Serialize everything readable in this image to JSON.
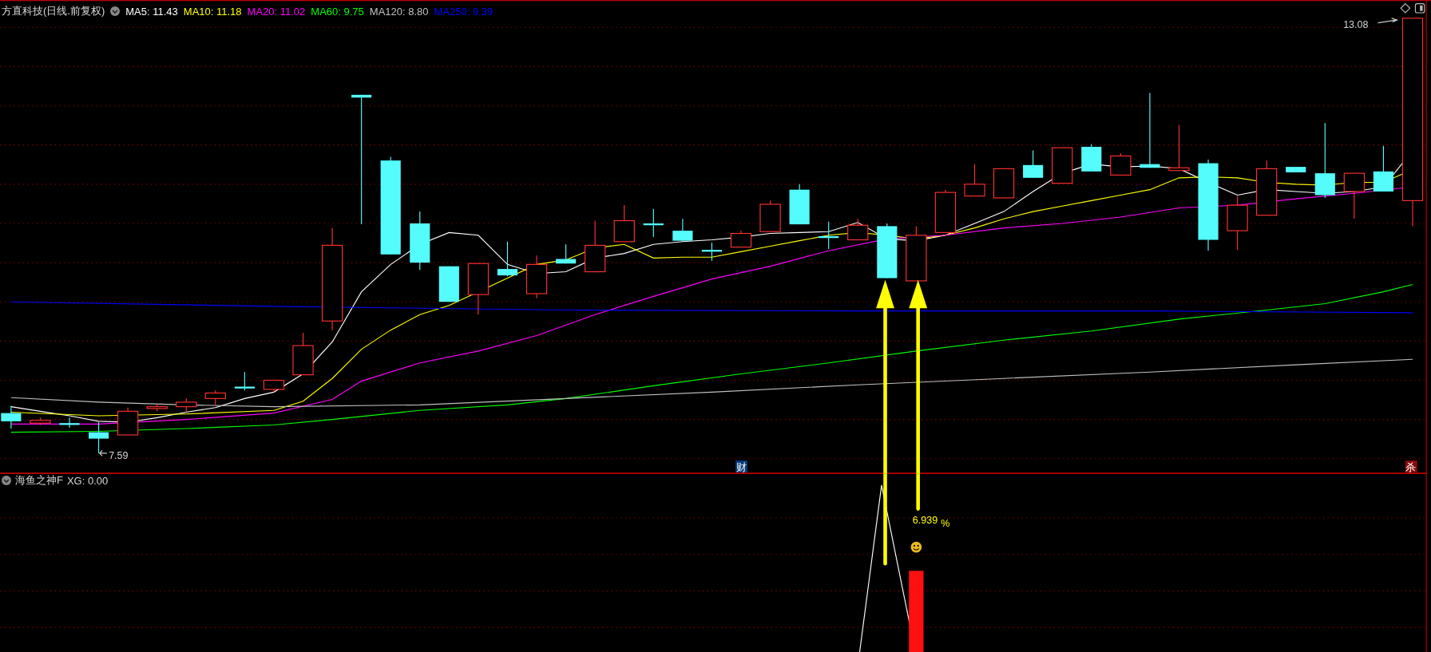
{
  "header": {
    "title": "方直科技(日线.前复权)",
    "indicators": [
      {
        "label": "MA5: 11.43",
        "color": "#ffffff"
      },
      {
        "label": "MA10: 11.18",
        "color": "#ffff00"
      },
      {
        "label": "MA20: 11.02",
        "color": "#ff00ff"
      },
      {
        "label": "MA60: 9.75",
        "color": "#00ff00"
      },
      {
        "label": "MA120: 8.80",
        "color": "#c0c0c0"
      },
      {
        "label": "MA250: 9.39",
        "color": "#0000ff"
      }
    ]
  },
  "price_chart": {
    "high_label": "13.08",
    "low_label": "7.59",
    "badges": [
      {
        "text": "财",
        "color": "#0a3a78"
      },
      {
        "text": "杀",
        "color": "#8a0a0a"
      }
    ]
  },
  "indicator_panel": {
    "title": "海鱼之神F",
    "reading": "XG: 0.00",
    "signal_value": "6.939",
    "signal_unit": "%"
  }
}
